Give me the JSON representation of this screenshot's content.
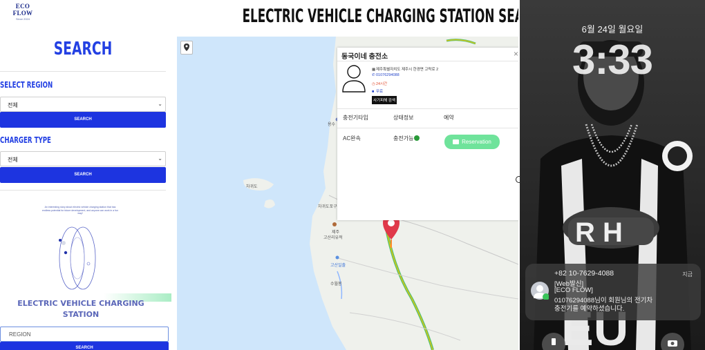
{
  "sidebar": {
    "logo_text": "ECO FLOW",
    "logo_sub": "Since 2024",
    "search_title": "SEARCH",
    "region_label": "SELECT REGION",
    "region_value": "전체",
    "search_button": "SEARCH",
    "charger_label": "CHARGER TYPE",
    "charger_value": "전체",
    "search_button_2": "SEARCH",
    "promo_text": "An interesting story about electric vehicle charging station that has endless potential for future development, and anyone can work in a fun way!",
    "ev_title_line1": "ELECTRIC VEHICLE CHARGING",
    "ev_title_line2": "STATION",
    "region_input_placeholder": "REGION",
    "search_button_3": "SEARCH"
  },
  "header": {
    "title": "ELECTRIC VEHICLE CHARGING STATION SEARCH"
  },
  "map": {
    "labels": {
      "jagwido": "차귀도",
      "jagwido_port": "차귀도포구",
      "gosan": "고산리유적",
      "jeju": "제주",
      "stop1": "고산일출",
      "port2": "수월봉",
      "top_stop": "용수"
    }
  },
  "popup": {
    "station_name": "동국이네 충전소",
    "address": "제주특별자치도 제주시 한경면 고락로 2",
    "phone": "01076294088",
    "hours": "24시간",
    "fee": "무료",
    "fraud_button": "사기피해 검색",
    "headers": [
      "충전기타입",
      "상태정보",
      "예약"
    ],
    "row": {
      "type": "AC완속",
      "status": "충전가능",
      "reserve_button": "Reservation"
    }
  },
  "phone": {
    "date": "6월 24일 월요일",
    "time": "3:33",
    "notification": {
      "sender": "+82 10-7629-4088",
      "time": "지금",
      "line1": "[Web발신]",
      "line2": "[ECO FLOW]",
      "line3": "01076294088님이 회원님의 전기차",
      "line4": "충전기를 예약하셨습니다."
    }
  },
  "colors": {
    "accent_blue": "#1d34e0",
    "title_blue": "#2340e3",
    "reserve_green": "#6fe39b",
    "status_green": "#2a9a3a",
    "marker_red": "#e0394a"
  }
}
